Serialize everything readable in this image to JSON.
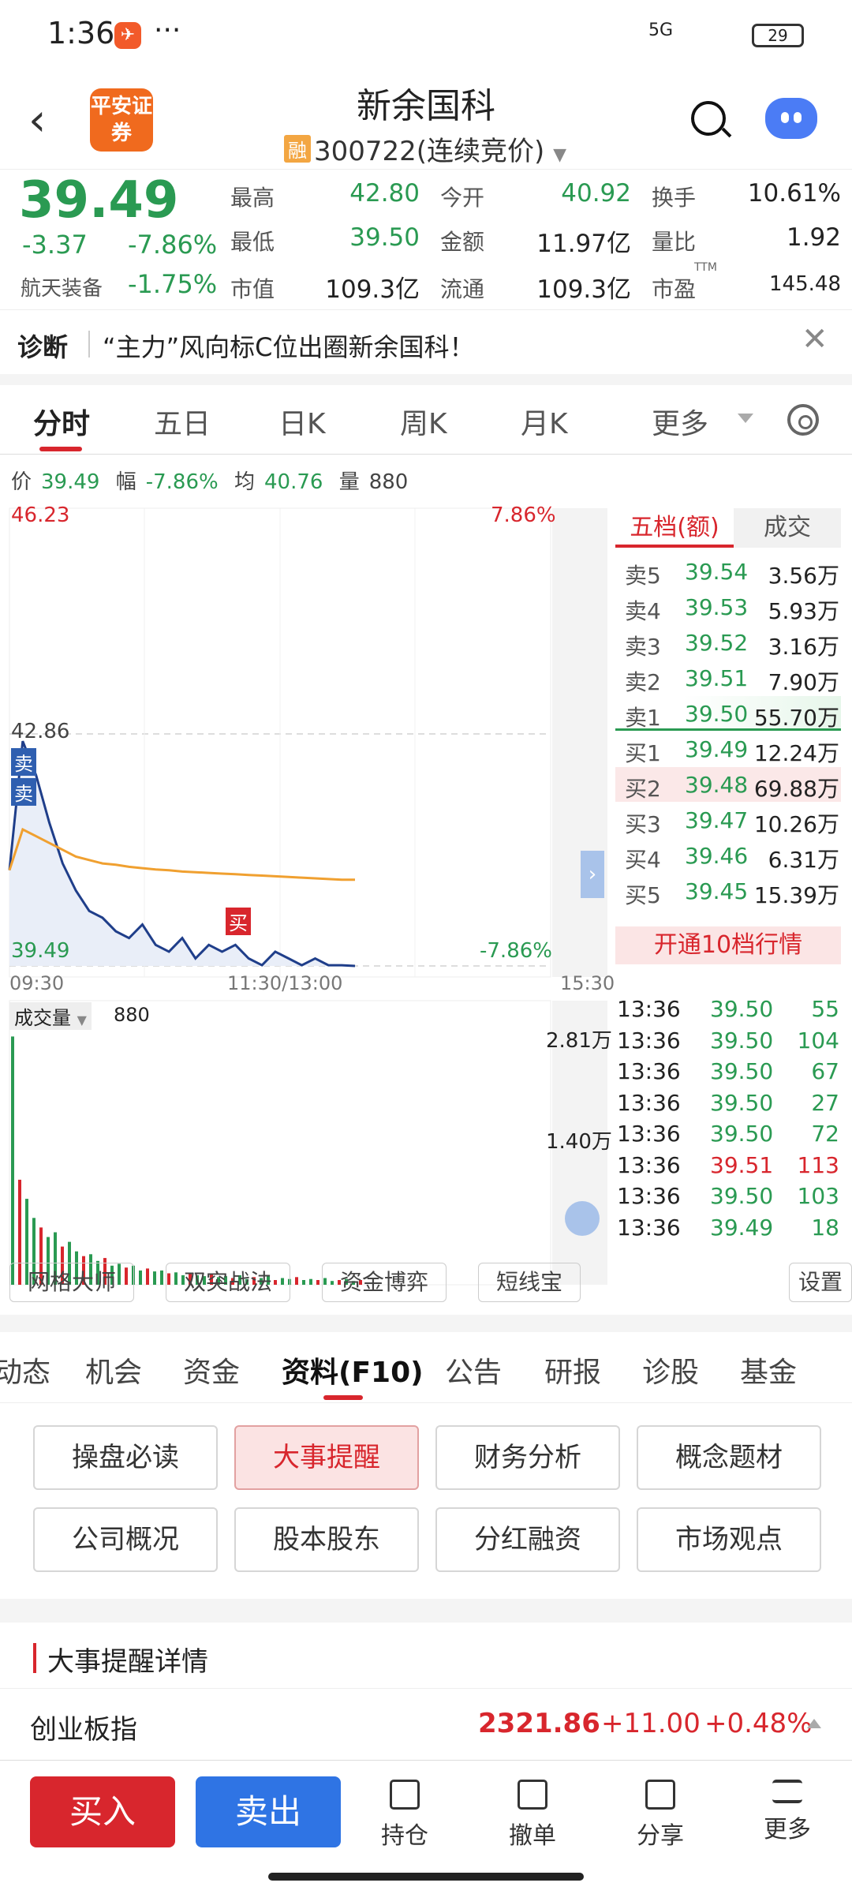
{
  "status": {
    "time": "1:36",
    "app_icon": "✈",
    "dots": "···",
    "signal": "5G",
    "battery": "29"
  },
  "header": {
    "logo": "平安证券",
    "name": "新余国科",
    "rong": "融",
    "code": "300722",
    "mode": "(连续竞价)"
  },
  "quote": {
    "price": "39.49",
    "change": "-3.37",
    "pct": "-7.86%",
    "sector": "航天装备",
    "sector_pct": "-1.75%",
    "l_high": "最高",
    "v_high": "42.80",
    "l_open": "今开",
    "v_open": "40.92",
    "l_turn": "换手",
    "v_turn": "10.61%",
    "l_low": "最低",
    "v_low": "39.50",
    "l_amt": "金额",
    "v_amt": "11.97亿",
    "l_vr": "量比",
    "v_vr": "1.92",
    "l_mcap": "市值",
    "v_mcap": "109.3亿",
    "l_float": "流通",
    "v_float": "109.3亿",
    "l_pe": "市盈",
    "pe_sup": "TTM",
    "v_pe": "145.48"
  },
  "diag": {
    "label": "诊断",
    "text": "“主力”风向标C位出圈新余国科！"
  },
  "tabs": [
    "分时",
    "五日",
    "日K",
    "周K",
    "月K",
    "更多"
  ],
  "info": {
    "l_price": "价",
    "price": "39.49",
    "l_amp": "幅",
    "amp": "-7.86%",
    "l_avg": "均",
    "avg": "40.76",
    "l_vol": "量",
    "vol": "880"
  },
  "chart": {
    "top": "46.23",
    "top_pct": "7.86%",
    "mid": "42.86",
    "bot": "39.49",
    "bot_pct": "-7.86%",
    "t0": "09:30",
    "t1": "11:30/13:00",
    "t2": "15:30",
    "sell1": "卖",
    "sell2": "卖",
    "buy": "买",
    "vol_label": "成交量",
    "vol_val": "880",
    "vol_max": "2.81万",
    "vol_mid": "1.40万"
  },
  "chart_data": {
    "type": "line",
    "title": "",
    "x_range": [
      "09:30",
      "15:30"
    ],
    "ylim": [
      39.49,
      46.23
    ],
    "series": [
      {
        "name": "价",
        "values": [
          40.9,
          42.8,
          42.3,
          41.6,
          41.0,
          40.6,
          40.3,
          40.2,
          40.0,
          39.9,
          40.1,
          39.8,
          39.7,
          39.9,
          39.6,
          39.8,
          39.7,
          39.8,
          39.6,
          39.5,
          39.7,
          39.6,
          39.5,
          39.6,
          39.5,
          39.5,
          39.49
        ]
      },
      {
        "name": "均",
        "values": [
          40.9,
          41.5,
          41.4,
          41.3,
          41.2,
          41.1,
          41.05,
          41.0,
          40.98,
          40.95,
          40.93,
          40.91,
          40.9,
          40.88,
          40.87,
          40.86,
          40.85,
          40.84,
          40.83,
          40.82,
          40.81,
          40.8,
          40.79,
          40.78,
          40.77,
          40.76,
          40.76
        ]
      }
    ]
  },
  "orderbook": {
    "h1": "五档(额)",
    "h2": "成交",
    "rows": [
      {
        "l": "卖5",
        "p": "39.54",
        "v": "3.56万"
      },
      {
        "l": "卖4",
        "p": "39.53",
        "v": "5.93万"
      },
      {
        "l": "卖3",
        "p": "39.52",
        "v": "3.16万"
      },
      {
        "l": "卖2",
        "p": "39.51",
        "v": "7.90万"
      },
      {
        "l": "卖1",
        "p": "39.50",
        "v": "55.70万"
      },
      {
        "l": "买1",
        "p": "39.49",
        "v": "12.24万"
      },
      {
        "l": "买2",
        "p": "39.48",
        "v": "69.88万"
      },
      {
        "l": "买3",
        "p": "39.47",
        "v": "10.26万"
      },
      {
        "l": "买4",
        "p": "39.46",
        "v": "6.31万"
      },
      {
        "l": "买5",
        "p": "39.45",
        "v": "15.39万"
      }
    ],
    "open": "开通10档行情"
  },
  "trades": [
    {
      "t": "13:36",
      "p": "39.50",
      "v": "55"
    },
    {
      "t": "13:36",
      "p": "39.50",
      "v": "104"
    },
    {
      "t": "13:36",
      "p": "39.50",
      "v": "67"
    },
    {
      "t": "13:36",
      "p": "39.50",
      "v": "27"
    },
    {
      "t": "13:36",
      "p": "39.50",
      "v": "72"
    },
    {
      "t": "13:36",
      "p": "39.51",
      "v": "113"
    },
    {
      "t": "13:36",
      "p": "39.50",
      "v": "103"
    },
    {
      "t": "13:36",
      "p": "39.49",
      "v": "18"
    }
  ],
  "tools": [
    "网格大师",
    "双突战法",
    "资金博弈",
    "短线宝",
    "设置"
  ],
  "ftabs": [
    "动态",
    "机会",
    "资金",
    "资料(F10)",
    "公告",
    "研报",
    "诊股",
    "基金"
  ],
  "fbtns": [
    "操盘必读",
    "大事提醒",
    "财务分析",
    "概念题材",
    "公司概况",
    "股本股东",
    "分红融资",
    "市场观点"
  ],
  "detail": "大事提醒详情",
  "index": {
    "name": "创业板指",
    "value": "2321.86",
    "change": "+11.00",
    "pct": "+0.48%"
  },
  "bottom": {
    "buy": "买入",
    "sell": "卖出",
    "items": [
      "持仓",
      "撤单",
      "分享",
      "更多"
    ]
  },
  "colors": {
    "up": "#d8262d",
    "down": "#2a9a52",
    "line": "#1f3e8a",
    "avg": "#f0a030"
  }
}
